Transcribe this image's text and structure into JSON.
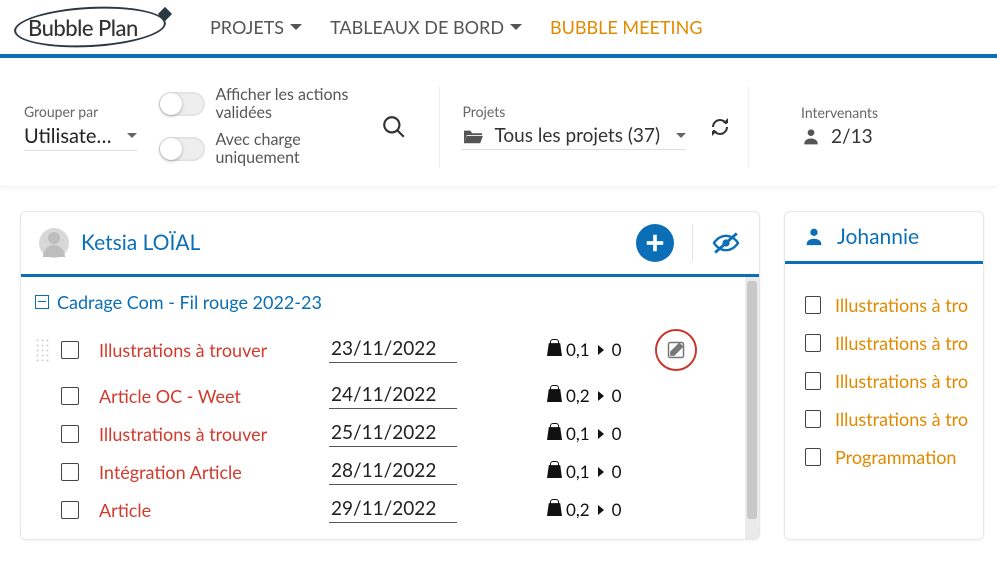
{
  "logo_text": "Bubble Plan",
  "nav": {
    "projects": "PROJETS",
    "dashboards": "TABLEAUX DE BORD",
    "meeting": "BUBBLE MEETING"
  },
  "filters": {
    "group_by_label": "Grouper par",
    "group_by_value": "Utilisate…",
    "toggle_validated": "Afficher les actions validées",
    "toggle_with_load": "Avec charge uniquement",
    "projects_label": "Projets",
    "projects_value": "Tous les projets (37)",
    "intervenants_label": "Intervenants",
    "intervenants_value": "2/13"
  },
  "left": {
    "user": "Ketsia LOÏAL",
    "group_title": "Cadrage Com - Fil rouge 2022-23",
    "tasks": [
      {
        "title": "Illustrations à trouver",
        "date": "23/11/2022",
        "weight": "0,1",
        "secondary": "0",
        "edit_highlight": true,
        "drag": true
      },
      {
        "title": "Article OC - Weet",
        "date": "24/11/2022",
        "weight": "0,2",
        "secondary": "0",
        "edit_highlight": false,
        "drag": false
      },
      {
        "title": "Illustrations à trouver",
        "date": "25/11/2022",
        "weight": "0,1",
        "secondary": "0",
        "edit_highlight": false,
        "drag": false
      },
      {
        "title": "Intégration Article",
        "date": "28/11/2022",
        "weight": "0,1",
        "secondary": "0",
        "edit_highlight": false,
        "drag": false
      },
      {
        "title": "Article",
        "date": "29/11/2022",
        "weight": "0,2",
        "secondary": "0",
        "edit_highlight": false,
        "drag": false
      }
    ]
  },
  "right": {
    "user": "Johannie",
    "tasks": [
      {
        "title": "Illustrations à tro"
      },
      {
        "title": "Illustrations à tro"
      },
      {
        "title": "Illustrations à tro"
      },
      {
        "title": "Illustrations à tro"
      },
      {
        "title": "Programmation"
      }
    ]
  }
}
